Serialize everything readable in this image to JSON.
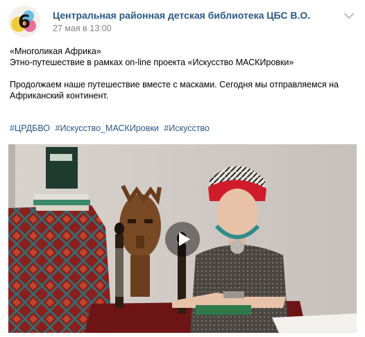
{
  "post": {
    "author": "Центральная районная детская библиотека ЦБС В.О.",
    "date": "27 мая в 13:00",
    "avatar_digit": "6",
    "menu_icon": "chevron-down-icon",
    "text_lines": [
      "«Многоликая Африка»",
      "Этно-путешествие в рамках on-line проекта «Искусство МАСКИровки»",
      "Продолжаем наше путешествие вместе с масками. Сегодня мы отправляемся на",
      "Африканский континент."
    ],
    "hashtags": [
      "#ЦРДБВО",
      "#Искусство_МАСКИровки",
      "#Искусство"
    ]
  },
  "video": {
    "play_icon": "play-icon"
  },
  "colors": {
    "link": "#2a5885",
    "secondary_text": "#828282",
    "avatar_accent": "#f0c419"
  }
}
